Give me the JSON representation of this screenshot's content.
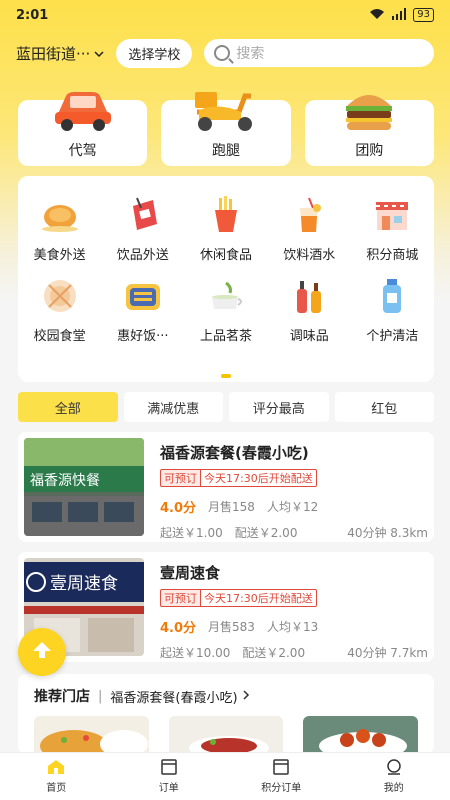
{
  "status": {
    "time": "2:01",
    "battery": "93"
  },
  "header": {
    "location": "蓝田街道···",
    "school_button": "选择学校",
    "search_placeholder": "搜索"
  },
  "services": [
    {
      "label": "代驾",
      "icon": "car-icon"
    },
    {
      "label": "跑腿",
      "icon": "scooter-icon"
    },
    {
      "label": "团购",
      "icon": "burger-icon"
    }
  ],
  "categories": [
    {
      "label": "美食外送",
      "icon": "roast-chicken-icon"
    },
    {
      "label": "饮品外送",
      "icon": "drink-bag-icon"
    },
    {
      "label": "休闲食品",
      "icon": "fries-icon"
    },
    {
      "label": "饮料酒水",
      "icon": "juice-icon"
    },
    {
      "label": "积分商城",
      "icon": "store-icon"
    },
    {
      "label": "校园食堂",
      "icon": "plate-icon"
    },
    {
      "label": "惠好饭···",
      "icon": "rice-bowl-icon"
    },
    {
      "label": "上品茗茶",
      "icon": "tea-icon"
    },
    {
      "label": "调味品",
      "icon": "condiment-icon"
    },
    {
      "label": "个护清洁",
      "icon": "cleanser-icon"
    }
  ],
  "filters": [
    "全部",
    "满减优惠",
    "评分最高",
    "红包"
  ],
  "shops": [
    {
      "name": "福香源套餐(春霞小吃)",
      "tag_preorder": "可预订",
      "tag_delivery": "今天17:30后开始配送",
      "rating": "4.0分",
      "monthly_sales": "月售158",
      "avg_price": "人均￥12",
      "min_order": "起送￥1.00",
      "delivery_fee": "配送￥2.00",
      "eta": "40分钟 8.3km",
      "sign_text": "福香源快餐"
    },
    {
      "name": "壹周速食",
      "tag_preorder": "可预订",
      "tag_delivery": "今天17:30后开始配送",
      "rating": "4.0分",
      "monthly_sales": "月售583",
      "avg_price": "人均￥13",
      "min_order": "起送￥10.00",
      "delivery_fee": "配送￥2.00",
      "eta": "40分钟 7.7km",
      "sign_text": "壹周速食"
    }
  ],
  "recommend": {
    "title": "推荐门店",
    "shop_link": "福香源套餐(春霞小吃)"
  },
  "tabbar": [
    {
      "label": "首页",
      "icon": "home-icon"
    },
    {
      "label": "订单",
      "icon": "order-icon"
    },
    {
      "label": "积分订单",
      "icon": "points-order-icon"
    },
    {
      "label": "我的",
      "icon": "profile-icon"
    }
  ],
  "colors": {
    "accent": "#fcd421",
    "price_orange": "#f07a0a",
    "tag_red": "#e04a3a"
  }
}
